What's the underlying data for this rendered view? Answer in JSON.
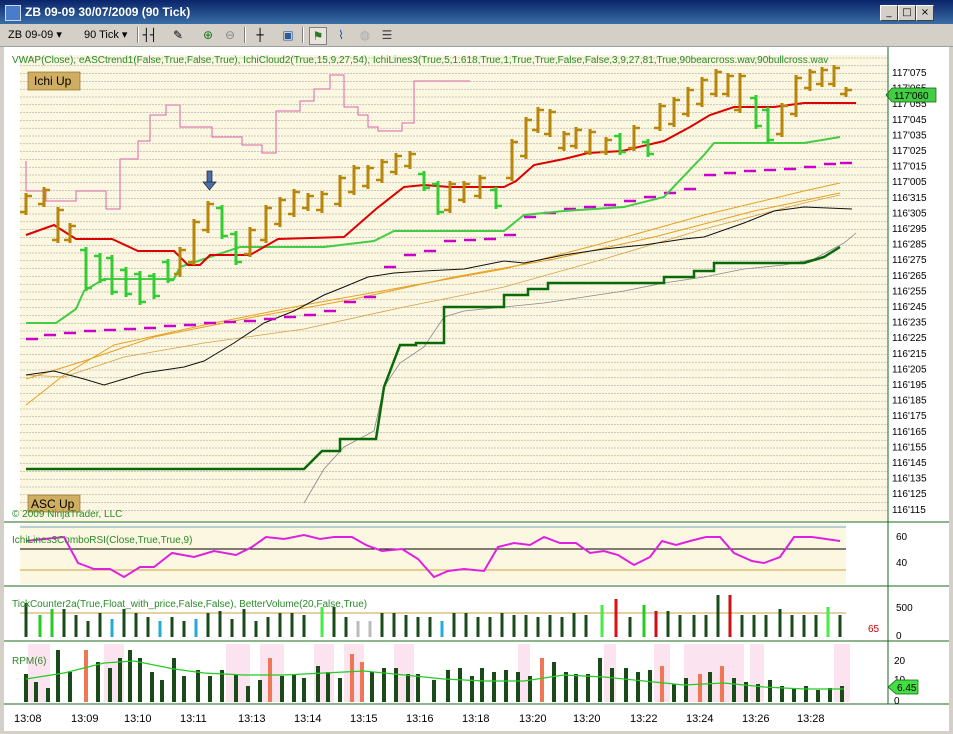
{
  "window": {
    "title": "ZB 09-09  30/07/2009 (90 Tick)",
    "minimize_icon": "minimize-icon",
    "maximize_icon": "maximize-icon",
    "close_icon": "close-icon"
  },
  "toolbar": {
    "instrument": "ZB 09-09",
    "period": "90 Tick",
    "icons": [
      "bar-type-icon",
      "drawing-pencil-icon",
      "zoom-in-icon",
      "zoom-out-icon",
      "crosshair-icon",
      "snapshot-icon",
      "strategy-icon",
      "indicator-icon",
      "globe-icon",
      "properties-icon"
    ]
  },
  "price_panel": {
    "header": "VWAP(Close), eASCtrend1(False,True,False,True), IchiCloud2(True,15,9,27,54), IchiLines3(True,5,1.618,True,1,True,True,False,False,3,9,27,81,True,90bearcross.wav,90bullcross.wav",
    "badge_top": "Ichi Up",
    "badge_bottom": "ASC Up",
    "copyright": "© 2009 NinjaTrader, LLC",
    "price_marker": "117'060",
    "y_labels": [
      "117'075",
      "117'065",
      "117'055",
      "117'045",
      "117'035",
      "117'025",
      "117'015",
      "117'005",
      "116'315",
      "116'305",
      "116'295",
      "116'285",
      "116'275",
      "116'265",
      "116'255",
      "116'245",
      "116'235",
      "116'225",
      "116'215",
      "116'205",
      "116'195",
      "116'185",
      "116'175",
      "116'165",
      "116'155",
      "116'145",
      "116'135",
      "116'125",
      "116'115"
    ]
  },
  "rsi_panel": {
    "header": "IchiLines3ComboRSI(Close,True,True,9)",
    "y_labels": [
      "60",
      "40"
    ]
  },
  "volume_panel": {
    "header": "TickCounter2a(True,Float_with_price,False,False), BetterVolume(20,False,True)",
    "y_labels": [
      "500",
      "0"
    ],
    "counter": "65"
  },
  "rpm_panel": {
    "header": "RPM(6)",
    "y_labels": [
      "20",
      "10",
      "0"
    ],
    "marker": "6.45"
  },
  "x_labels": [
    "13:08",
    "13:09",
    "13:10",
    "13:11",
    "13:13",
    "13:14",
    "13:15",
    "13:16",
    "13:18",
    "13:20",
    "13:20",
    "13:22",
    "13:24",
    "13:26",
    "13:28"
  ],
  "colors": {
    "up_bar": "#b8860b",
    "down_bar": "#33cc33",
    "kijun": "#dd0000",
    "tenkan": "#44cc44",
    "cloud_dark": "#006400",
    "pink": "#dd66aa",
    "magenta": "#cc00cc",
    "orange": "#e8a020",
    "rsi": "#e020e0",
    "rpm_line": "#22cc22"
  }
}
